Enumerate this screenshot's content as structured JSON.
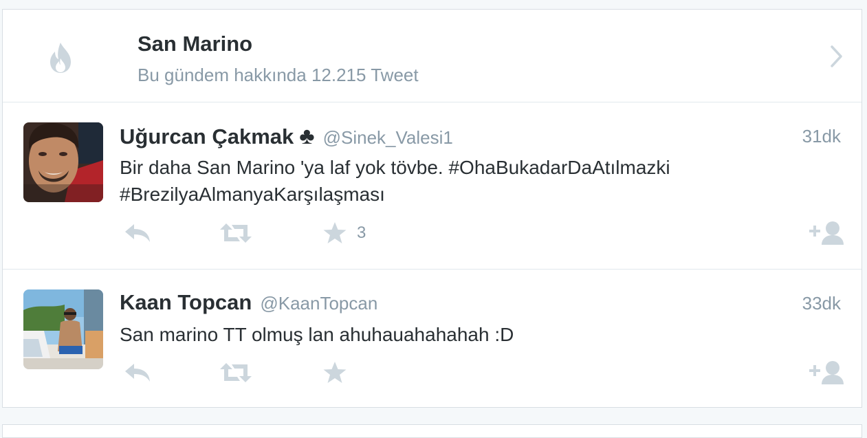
{
  "trend": {
    "title": "San Marino",
    "subtitle": "Bu gündem hakkında 12.215 Tweet",
    "icon": "flame-icon"
  },
  "tweets": [
    {
      "fullname": "Uğurcan Çakmak",
      "badge": "♣",
      "handle": "@Sinek_Valesi1",
      "time": "31dk",
      "text_line1": "Bir daha San Marino 'ya laf yok tövbe. #OhaBukadarDaAtılmazki",
      "text_line2": "#BrezilyaAlmanyaKarşılaşması",
      "favorites": "3"
    },
    {
      "fullname": "Kaan Topcan",
      "handle": "@KaanTopcan",
      "time": "33dk",
      "text_line1": "San marino TT olmuş lan ahuhauahahahah :D"
    }
  ],
  "colors": {
    "icon_gray": "#ccd6dd",
    "muted_text": "#8899a6",
    "primary_text": "#292f33"
  }
}
